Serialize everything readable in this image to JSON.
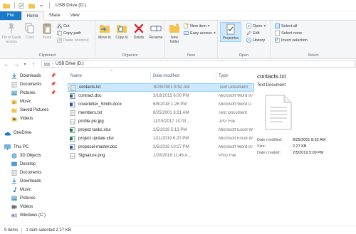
{
  "titlebar": {
    "title": "USB Drive (D:)"
  },
  "tabs": [
    {
      "label": "File"
    },
    {
      "label": "Home"
    },
    {
      "label": "Share"
    },
    {
      "label": "View"
    }
  ],
  "ribbon": {
    "clipboard": {
      "pin": "Pin to Quick access",
      "copy": "Copy",
      "paste": "Paste",
      "cut": "Cut",
      "copy_path": "Copy path",
      "paste_shortcut": "Paste shortcut",
      "label": "Clipboard"
    },
    "organize": {
      "move_to": "Move to",
      "copy_to": "Copy to",
      "delete": "Delete",
      "rename": "Rename",
      "label": "Organize"
    },
    "new": {
      "new_folder": "New folder",
      "new_item": "New item",
      "easy_access": "Easy access",
      "label": "New"
    },
    "open": {
      "properties": "Properties",
      "open": "Open",
      "edit": "Edit",
      "history": "History",
      "label": "Open"
    },
    "select": {
      "select_all": "Select all",
      "select_none": "Select none",
      "invert_selection": "Invert selection",
      "label": "Select"
    }
  },
  "address": {
    "path": "USB Drive (D:)"
  },
  "navpane": {
    "items": [
      {
        "label": "Downloads",
        "pinned": true
      },
      {
        "label": "Documents",
        "pinned": true
      },
      {
        "label": "Pictures",
        "pinned": true
      },
      {
        "label": "Music",
        "pinned": false
      },
      {
        "label": "Saved Pictures",
        "pinned": false
      },
      {
        "label": "Videos",
        "pinned": false
      },
      {
        "label": "OneDrive",
        "pinned": false
      },
      {
        "label": "This PC",
        "pinned": false
      },
      {
        "label": "3D Objects",
        "pinned": false
      },
      {
        "label": "Desktop",
        "pinned": false
      },
      {
        "label": "Documents",
        "pinned": false
      },
      {
        "label": "Downloads",
        "pinned": false
      },
      {
        "label": "Music",
        "pinned": false
      },
      {
        "label": "Pictures",
        "pinned": false
      },
      {
        "label": "Videos",
        "pinned": false
      },
      {
        "label": "Windows (C:)",
        "pinned": false
      }
    ]
  },
  "filelist": {
    "columns": {
      "name": "Name",
      "date": "Date modified",
      "type": "Type"
    },
    "rows": [
      {
        "name": "contacts.txt",
        "date": "8/25/2001 8:52 AM",
        "type": "Text Document",
        "icon": "text-file-icon",
        "selected": true
      },
      {
        "name": "contract.doc",
        "date": "3/18/2015 6:00 PM",
        "type": "Microsoft Word 97",
        "icon": "word-doc-icon",
        "selected": false
      },
      {
        "name": "coverletter_Smith.docx",
        "date": "6/8/2018 1:26 PM",
        "type": "Microsoft Word D",
        "icon": "word-doc-icon",
        "selected": false
      },
      {
        "name": "members.txt",
        "date": "8/25/2001 8:31 AM",
        "type": "Text Document",
        "icon": "text-file-icon",
        "selected": false
      },
      {
        "name": "profile-pic.jpg",
        "date": "11/15/2017 10:03 ...",
        "type": "JPG File",
        "icon": "image-file-icon",
        "selected": false
      },
      {
        "name": "project tasks.xlsx",
        "date": "2/5/2019 5:13 PM",
        "type": "Microsoft Excel W",
        "icon": "excel-file-icon",
        "selected": false
      },
      {
        "name": "project update.xlsx",
        "date": "1/11/2019 6:20 PM",
        "type": "Microsoft Excel W",
        "icon": "excel-file-icon",
        "selected": false
      },
      {
        "name": "proposal-master.doc",
        "date": "2/5/2019 10:27 PM",
        "type": "Microsoft Word 97",
        "icon": "word-doc-icon",
        "selected": false
      },
      {
        "name": "Signature.png",
        "date": "1/26/2018 11:46 A...",
        "type": "PNG File",
        "icon": "image-file-icon",
        "selected": false
      }
    ]
  },
  "preview": {
    "title": "contacts.txt",
    "type": "Text Document",
    "props": [
      {
        "label": "Date modified:",
        "value": "8/25/2001 8:52 AM"
      },
      {
        "label": "Size:",
        "value": "2.27 KB"
      },
      {
        "label": "Date created:",
        "value": "2/5/2019 5:09 PM"
      }
    ]
  },
  "status": {
    "count": "9 items",
    "selection": "1 item selected  2.27 KB"
  },
  "colors": {
    "accent": "#1979ca",
    "selection": "#cce8ff",
    "folder": "#f3c450"
  }
}
